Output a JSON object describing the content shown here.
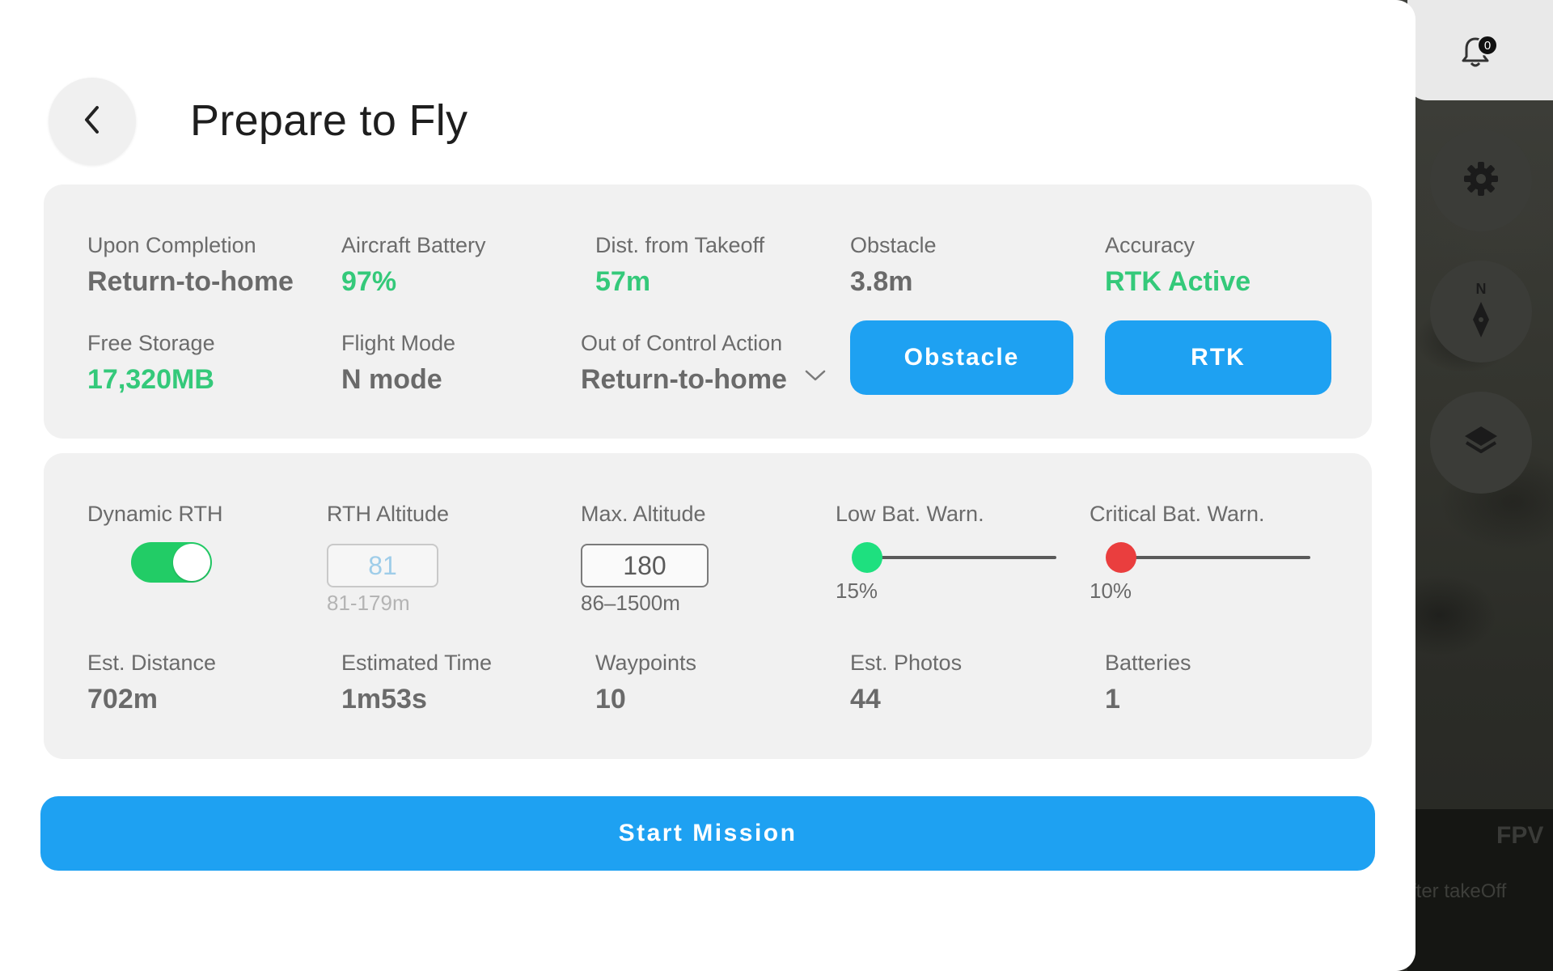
{
  "header": {
    "title": "Prepare to Fly"
  },
  "status": {
    "upon_completion": {
      "label": "Upon Completion",
      "value": "Return-to-home"
    },
    "aircraft_battery": {
      "label": "Aircraft Battery",
      "value": "97%"
    },
    "dist_from_takeoff": {
      "label": "Dist. from Takeoff",
      "value": "57m"
    },
    "obstacle": {
      "label": "Obstacle",
      "value": "3.8m"
    },
    "accuracy": {
      "label": "Accuracy",
      "value": "RTK Active"
    },
    "free_storage": {
      "label": "Free Storage",
      "value": "17,320MB"
    },
    "flight_mode": {
      "label": "Flight Mode",
      "value": "N mode"
    },
    "out_of_control": {
      "label": "Out of Control Action",
      "value": "Return-to-home"
    },
    "obstacle_button": "Obstacle",
    "rtk_button": "RTK"
  },
  "settings": {
    "dynamic_rth": {
      "label": "Dynamic RTH",
      "enabled": true
    },
    "rth_altitude": {
      "label": "RTH Altitude",
      "value": "81",
      "range": "81-179m"
    },
    "max_altitude": {
      "label": "Max. Altitude",
      "value": "180",
      "range": "86–1500m"
    },
    "low_bat": {
      "label": "Low Bat. Warn.",
      "value": "15%",
      "knob_color": "#1ee07f"
    },
    "critical_bat": {
      "label": "Critical Bat. Warn.",
      "value": "10%",
      "knob_color": "#ea3e3e"
    }
  },
  "estimates": {
    "distance": {
      "label": "Est. Distance",
      "value": "702m"
    },
    "time": {
      "label": "Estimated Time",
      "value": "1m53s"
    },
    "waypoints": {
      "label": "Waypoints",
      "value": "10"
    },
    "photos": {
      "label": "Est. Photos",
      "value": "44"
    },
    "batteries": {
      "label": "Batteries",
      "value": "1"
    }
  },
  "actions": {
    "start_mission": "Start Mission"
  },
  "sidebar": {
    "notification_count": "0",
    "fpv_label": "FPV",
    "takeoff_text": "fter takeOff"
  },
  "colors": {
    "accent": "#1ea1f2",
    "green": "#34c97a",
    "toggle_on": "#22cc66",
    "critical": "#ea3e3e"
  }
}
